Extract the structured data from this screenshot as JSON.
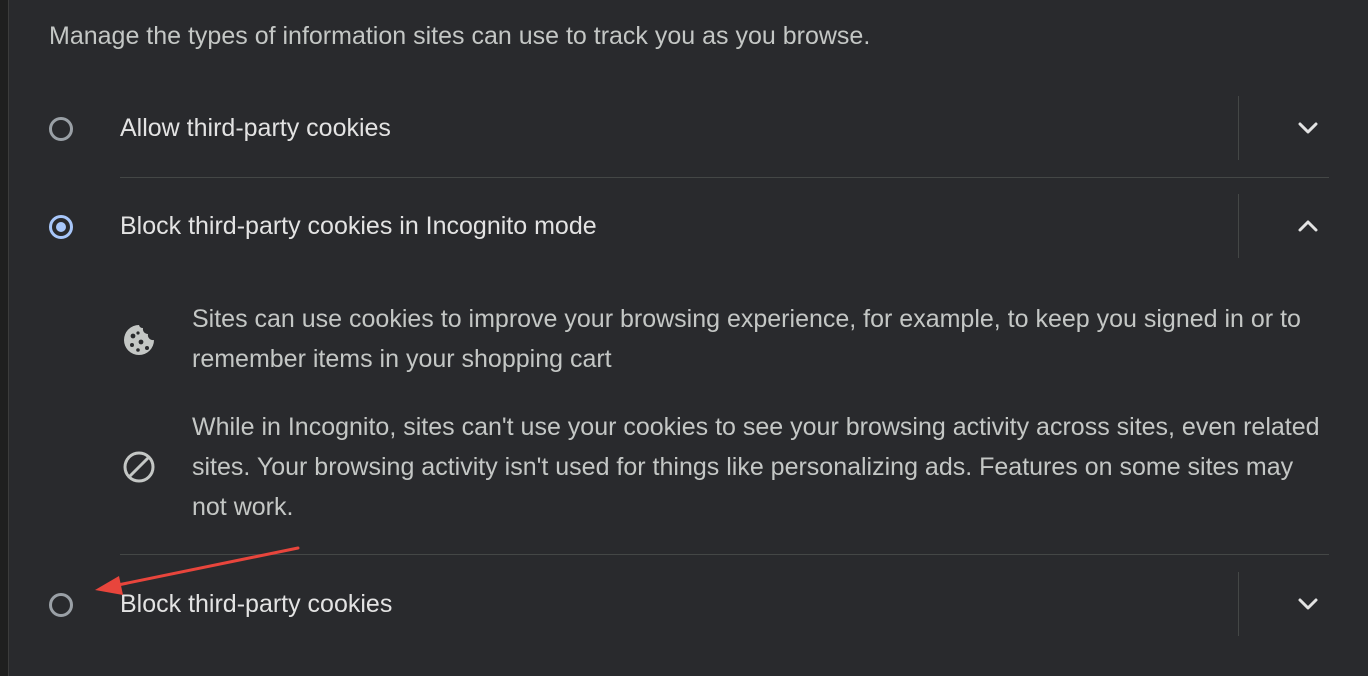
{
  "intro_text": "Manage the types of information sites can use to track you as you browse.",
  "options": [
    {
      "label": "Allow third-party cookies",
      "selected": false,
      "expanded": false
    },
    {
      "label": "Block third-party cookies in Incognito mode",
      "selected": true,
      "expanded": true
    },
    {
      "label": "Block third-party cookies",
      "selected": false,
      "expanded": false
    }
  ],
  "incognito_details": [
    {
      "icon": "cookie-icon",
      "text": "Sites can use cookies to improve your browsing experience, for example, to keep you signed in or to remember items in your shopping cart"
    },
    {
      "icon": "block-icon",
      "text": "While in Incognito, sites can't use your cookies to see your browsing activity across sites, even related sites. Your browsing activity isn't used for things like personalizing ads. Features on some sites may not work."
    }
  ],
  "colors": {
    "background": "#292a2d",
    "accent": "#a8c7fa",
    "annotation_arrow": "#e8453c"
  }
}
